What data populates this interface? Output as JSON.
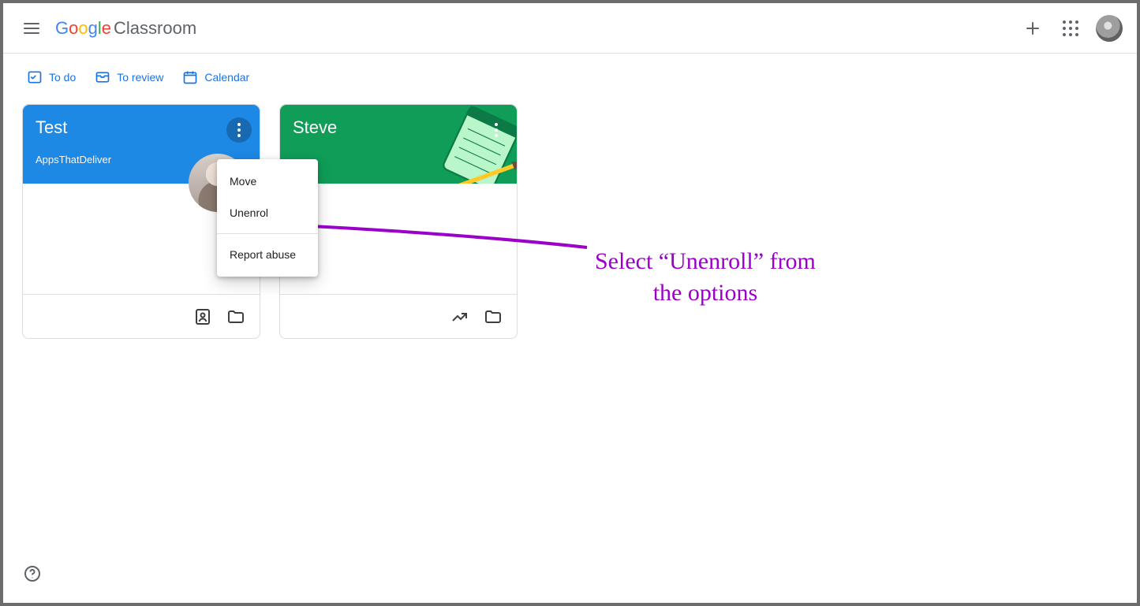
{
  "header": {
    "product": "Classroom"
  },
  "toolbar": {
    "todo": "To do",
    "toreview": "To review",
    "calendar": "Calendar"
  },
  "cards": [
    {
      "title": "Test",
      "subtitle": "AppsThatDeliver",
      "headerColor": "blue",
      "showTeacherAvatar": true,
      "footer": "assignment-folder"
    },
    {
      "title": "Steve",
      "subtitle": "",
      "headerColor": "green",
      "showTeacherAvatar": false,
      "footer": "trend-folder"
    }
  ],
  "menu": {
    "move": "Move",
    "unenrol": "Unenrol",
    "report": "Report abuse"
  },
  "annotation": {
    "line1": "Select “Unenroll” from",
    "line2": "the options"
  }
}
